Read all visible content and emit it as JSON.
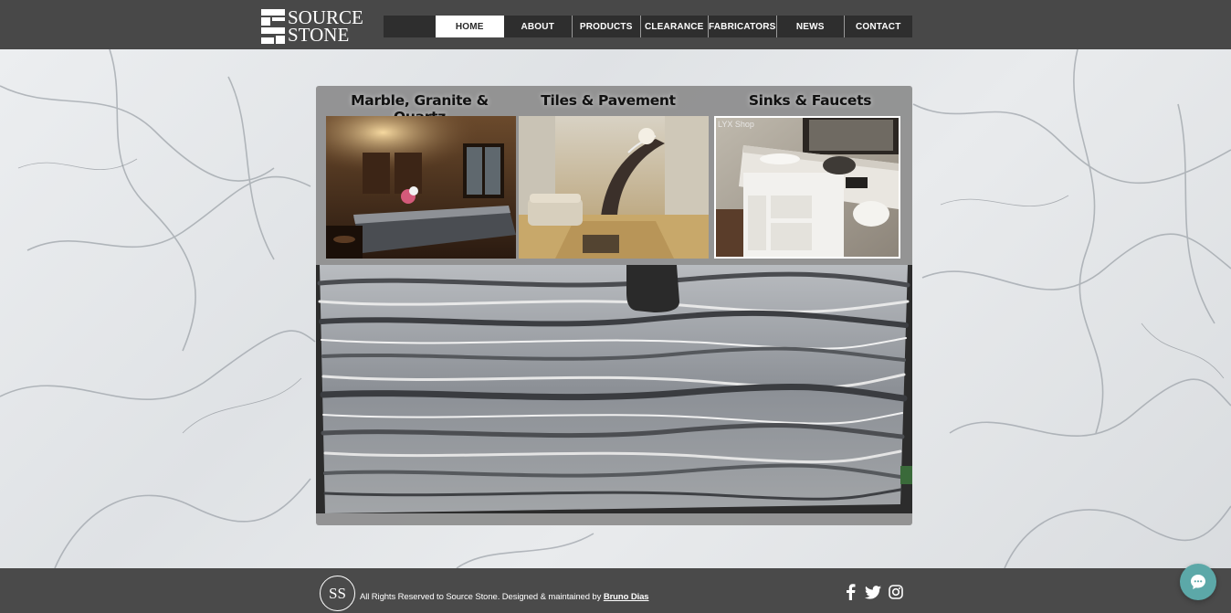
{
  "brand": {
    "logo_line1": "SOURCE",
    "logo_line2": "STONE"
  },
  "nav": {
    "items": [
      {
        "label": "HOME",
        "active": true
      },
      {
        "label": "ABOUT"
      },
      {
        "label": "PRODUCTS"
      },
      {
        "label": "CLEARANCE"
      },
      {
        "label": "FABRICATORS"
      },
      {
        "label": "NEWS"
      },
      {
        "label": "CONTACT"
      }
    ]
  },
  "categories": [
    {
      "title": "Marble, Granite & Quartz",
      "image": "kitchen-photo"
    },
    {
      "title": "Tiles & Pavement",
      "image": "lobby-photo"
    },
    {
      "title": "Sinks & Faucets",
      "image": "bathroom-vanity-photo",
      "watermark": "LYX Shop"
    }
  ],
  "hero": {
    "image": "marble-slab-photo"
  },
  "footer": {
    "badge": "SS",
    "copyright_text": "All Rights Reserved to Source Stone. Designed & maintained by ",
    "author_link": "Bruno Dias",
    "social": [
      "facebook-icon",
      "twitter-icon",
      "instagram-icon"
    ]
  },
  "chat": {
    "icon": "chat-bubble-icon"
  },
  "colors": {
    "header_bg": "#484848",
    "nav_bg": "#2e2e2e",
    "active_tab_bg": "#ffffff",
    "panel_bg": "#8c8c8c",
    "footer_bg": "#4a4a4a",
    "chat_btn": "#5ca8a8"
  }
}
